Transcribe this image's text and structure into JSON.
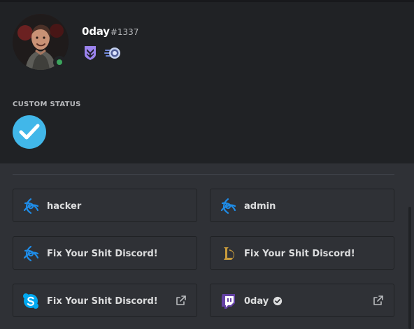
{
  "profile": {
    "username": "0day",
    "discriminator": "#1337",
    "avatar": {
      "image": "person-portrait",
      "status": "online",
      "status_color": "#3ba55d"
    },
    "badges": [
      {
        "icon": "hypesquad-bravery-badge-icon",
        "color": "#9c84ef"
      },
      {
        "icon": "nitro-boost-badge-icon",
        "color": "#7289da"
      }
    ]
  },
  "custom_status": {
    "label": "CUSTOM STATUS",
    "emoji": {
      "icon": "checkmark-icon",
      "color": "#41b7e9"
    }
  },
  "connections": [
    {
      "name": "hacker",
      "icon": "battle-net-icon",
      "icon_color": "#1f8ce7",
      "verified": false,
      "external_link": false
    },
    {
      "name": "admin",
      "icon": "battle-net-icon",
      "icon_color": "#1f8ce7",
      "verified": false,
      "external_link": false
    },
    {
      "name": "Fix Your Shit Discord!",
      "icon": "battle-net-icon",
      "icon_color": "#1f8ce7",
      "verified": false,
      "external_link": false
    },
    {
      "name": "Fix Your Shit Discord!",
      "icon": "league-of-legends-icon",
      "icon_color": "#c89b3c",
      "verified": false,
      "external_link": false
    },
    {
      "name": "Fix Your Shit Discord!",
      "icon": "skype-icon",
      "icon_color": "#00a8f0",
      "verified": false,
      "external_link": true
    },
    {
      "name": "0day",
      "icon": "twitch-icon",
      "icon_color": "#6441a5",
      "verified": true,
      "external_link": true
    }
  ],
  "theme": {
    "header_background": "#202225",
    "body_background": "#2f3136",
    "tile_border": "#202225",
    "text_primary": "#ffffff",
    "text_muted": "#b9bbbe"
  }
}
